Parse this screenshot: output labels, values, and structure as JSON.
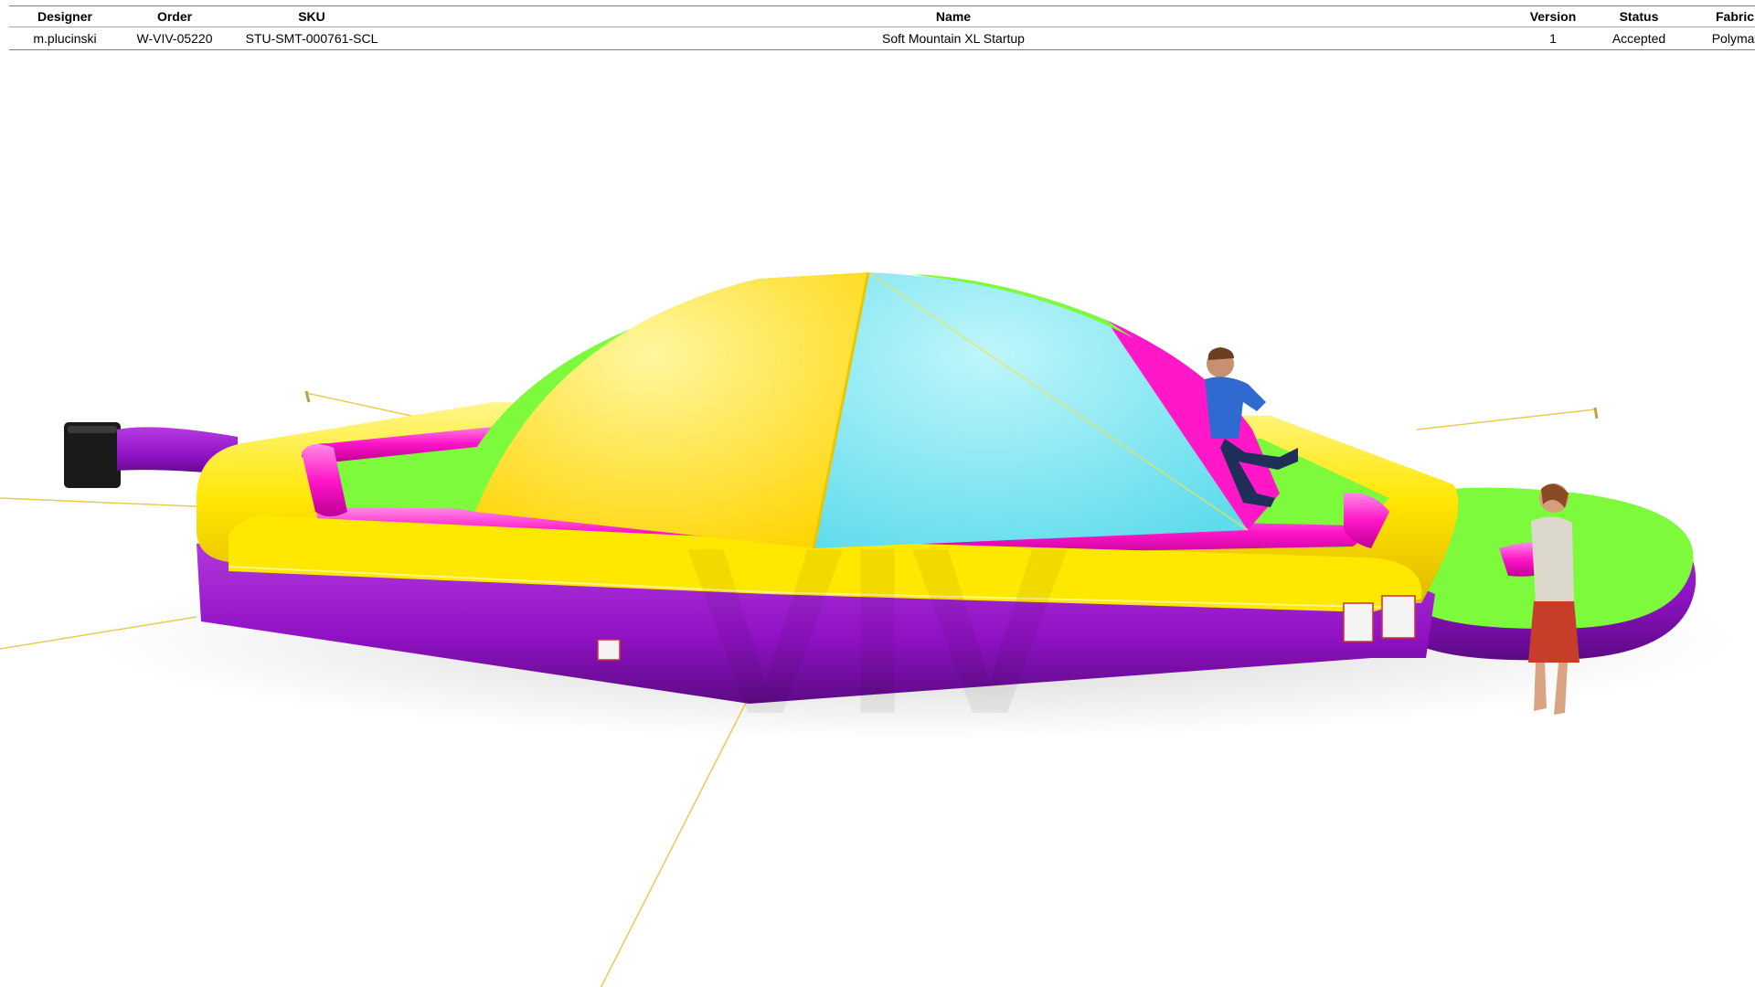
{
  "table": {
    "headers": {
      "designer": "Designer",
      "order": "Order",
      "sku": "SKU",
      "name": "Name",
      "version": "Version",
      "status": "Status",
      "fabric": "Fabric"
    },
    "row": {
      "designer": "m.plucinski",
      "order": "W-VIV-05220",
      "sku": "STU-SMT-000761-SCL",
      "name": "Soft Mountain XL Startup",
      "version": "1",
      "status": "Accepted",
      "fabric": "Polymat"
    }
  },
  "product_image": {
    "watermark": "VIV",
    "colors": {
      "yellow": "#ffe800",
      "green": "#7dfa3c",
      "cyan": "#7de8f5",
      "magenta": "#ff17c8",
      "purple": "#9a16c8"
    }
  }
}
